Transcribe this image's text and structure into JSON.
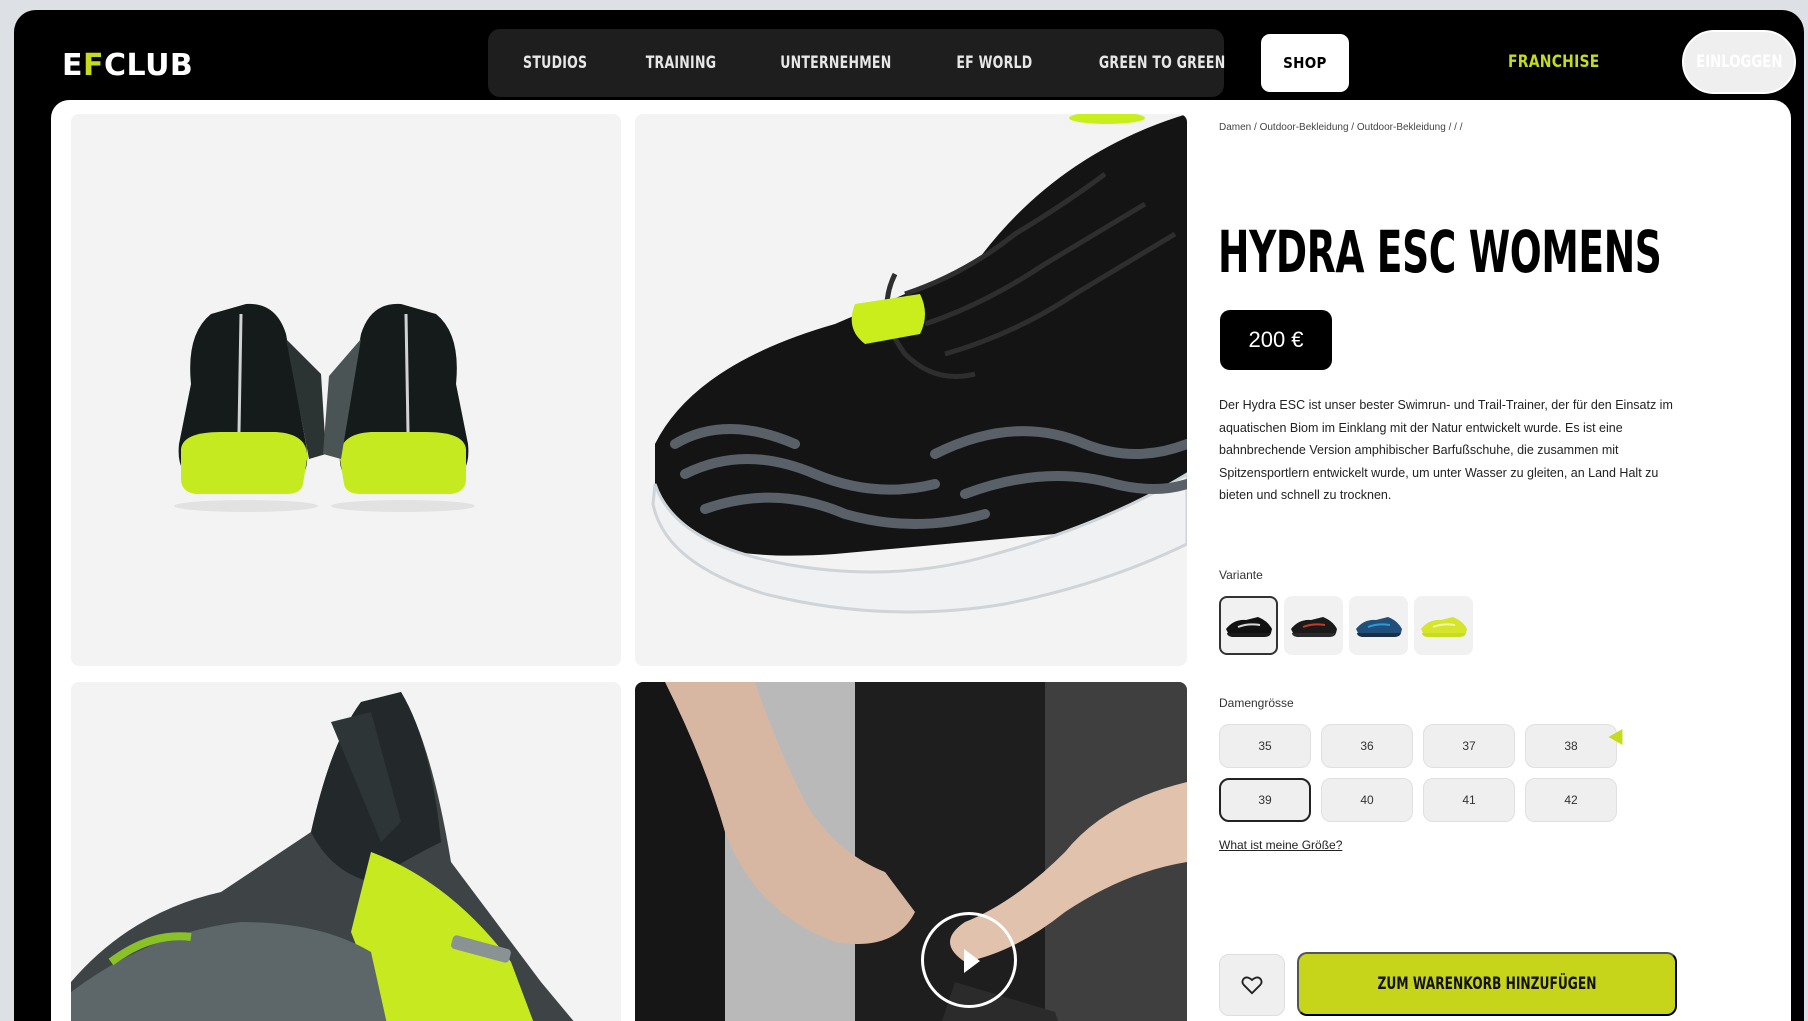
{
  "header": {
    "logo": {
      "prefix": "E",
      "mid": "F",
      "suffix": "CLUB"
    },
    "nav": [
      "Studios",
      "Training",
      "Unternehmen",
      "EF World",
      "Green to Green",
      "Shop"
    ],
    "active_nav": "Shop",
    "franchise": "Franchise",
    "login": "Einloggen"
  },
  "breadcrumb": "Damen / Outdoor-Bekleidung / Outdoor-Bekleidung / / /",
  "product": {
    "title": "HYDRA ESC WOMENS",
    "price": "200 €",
    "description": "Der Hydra ESC ist unser bester Swimrun- und Trail-Trainer, der für den Einsatz im aquatischen Biom im Einklang mit der Natur entwickelt wurde. Es ist eine bahnbrechende Version amphibischer Barfußschuhe, die zusammen mit Spitzensportlern entwickelt wurde, um unter Wasser zu gleiten, an Land Halt zu bieten und schnell zu trocknen.",
    "variant_label": "Variante",
    "variants": [
      {
        "name": "black-grey",
        "sole": "#1b1b1b",
        "upper": "#111111",
        "accent": "#d8d8d8"
      },
      {
        "name": "black-red",
        "sole": "#2a2a2a",
        "upper": "#1a1a1a",
        "accent": "#c23b2b"
      },
      {
        "name": "blue",
        "sole": "#1c2f40",
        "upper": "#1f4f7a",
        "accent": "#2d9ad1"
      },
      {
        "name": "lime",
        "sole": "#c8dd1e",
        "upper": "#d4e52c",
        "accent": "#f1f7a1"
      }
    ],
    "size_label": "Damengrösse",
    "sizes": [
      "35",
      "36",
      "37",
      "38",
      "39",
      "40",
      "41",
      "42"
    ],
    "selected_size": "39",
    "size_help": "What ist meine Größe?",
    "cart_button": "Zum Warenkorb hinzufügen"
  },
  "colors": {
    "accent": "#c6db1b",
    "frame": "#000000"
  }
}
